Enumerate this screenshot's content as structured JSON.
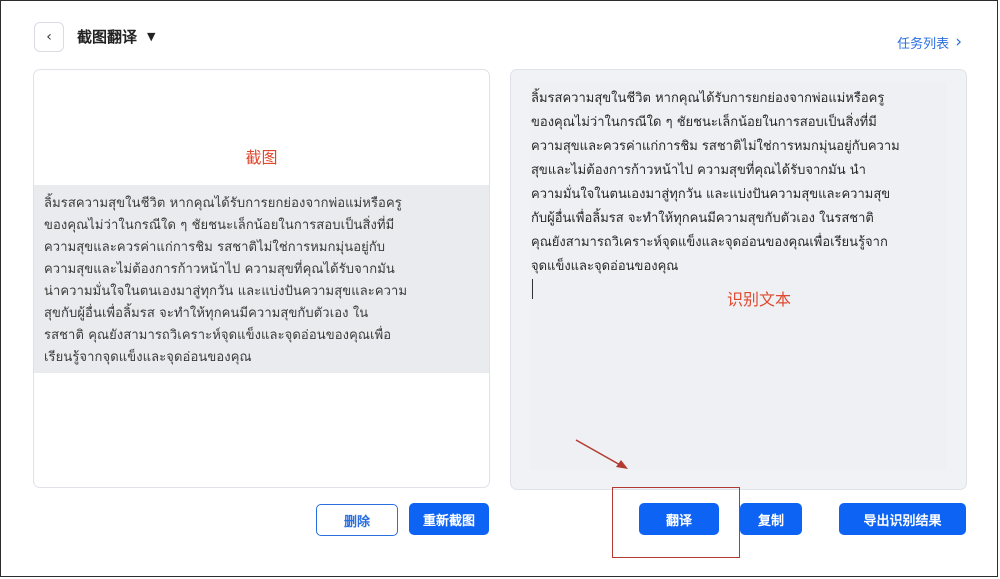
{
  "header": {
    "back_icon": "‹",
    "title": "截图翻译",
    "title_caret": "▼",
    "task_list_label": "任务列表",
    "task_list_chevron": "›"
  },
  "left_panel": {
    "label": "截图",
    "screenshot_text": "ลิ้มรสความสุขในชีวิต หากคุณได้รับการยกย่องจากพ่อแม่หรือครู\nของคุณไม่ว่าในกรณีใด ๆ ชัยชนะเล็กน้อยในการสอบเป็นสิ่งที่มี\nความสุขและควรค่าแก่การชิม รสชาติไม่ใช่การหมกมุ่นอยู่กับ\nความสุขและไม่ต้องการก้าวหน้าไป ความสุขที่คุณได้รับจากมัน\nน่าความมั่นใจในตนเองมาสู่ทุกวัน และแบ่งปันความสุขและความ\nสุขกับผู้อื่นเพื่อลิ้มรส จะทำให้ทุกคนมีความสุขกับตัวเอง ใน\nรสชาติ คุณยังสามารถวิเคราะห์จุดแข็งและจุดอ่อนของคุณเพื่อ\nเรียนรู้จากจุดแข็งและจุดอ่อนของคุณ"
  },
  "right_panel": {
    "label": "识别文本",
    "ocr_text": "ลิ้มรสความสุขในชีวิต หากคุณได้รับการยกย่องจากพ่อแม่หรือครู\nของคุณไม่ว่าในกรณีใด ๆ ชัยชนะเล็กน้อยในการสอบเป็นสิ่งที่มี\nความสุขและควรค่าแก่การชิม รสชาติไม่ใช่การหมกมุ่นอยู่กับความ\nสุขและไม่ต้องการก้าวหน้าไป ความสุขที่คุณได้รับจากมัน นำ\nความมั่นใจในตนเองมาสู่ทุกวัน และแบ่งปันความสุขและความสุข\nกับผู้อื่นเพื่อลิ้มรส จะทำให้ทุกคนมีความสุขกับตัวเอง ในรสชาติ\nคุณยังสามารถวิเคราะห์จุดแข็งและจุดอ่อนของคุณเพื่อเรียนรู้จาก\nจุดแข็งและจุดอ่อนของคุณ"
  },
  "buttons": {
    "delete": "删除",
    "recapture": "重新截图",
    "translate": "翻译",
    "copy": "复制",
    "export": "导出识别结果"
  },
  "colors": {
    "accent": "#0d63f3",
    "annotation": "#e0492f",
    "highlight": "#b23a30"
  }
}
